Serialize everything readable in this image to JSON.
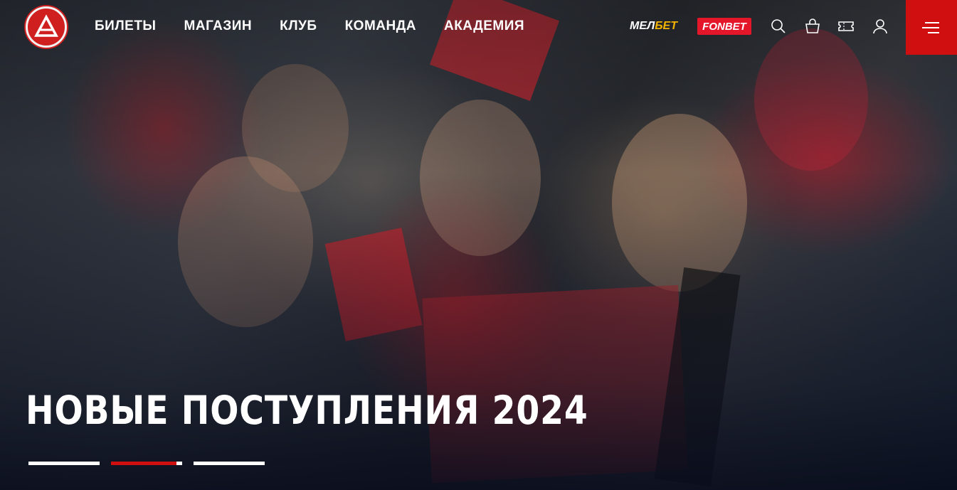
{
  "nav": {
    "items": [
      {
        "label": "БИЛЕТЫ"
      },
      {
        "label": "МАГАЗИН"
      },
      {
        "label": "КЛУБ"
      },
      {
        "label": "КОМАНДА"
      },
      {
        "label": "АКАДЕМИЯ"
      }
    ]
  },
  "sponsors": {
    "melbet_a": "МЕЛ",
    "melbet_b": "БЕТ",
    "fonbet": "FONBET"
  },
  "icons": {
    "search": "search-icon",
    "cart": "cart-icon",
    "ticket": "ticket-icon",
    "user": "user-icon",
    "menu": "hamburger-menu-icon"
  },
  "hero": {
    "headline": "НОВЫЕ ПОСТУПЛЕНИЯ 2024"
  },
  "slider": {
    "slide_count": 3,
    "active_index": 1,
    "active_progress": 0.92
  },
  "colors": {
    "brand_red": "#d01010",
    "fonbet_red": "#e3162a",
    "melbet_yellow": "#f2b400"
  }
}
